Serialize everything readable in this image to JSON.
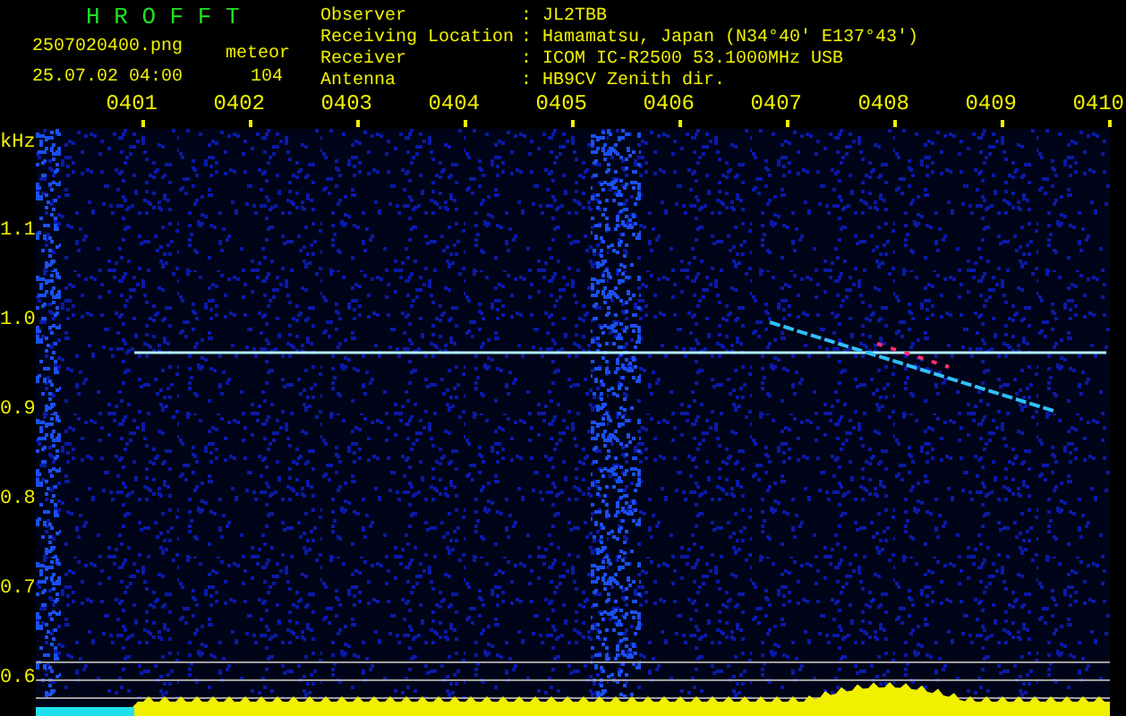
{
  "header": {
    "title": "H R O F F T",
    "file_name": "2507020400.png",
    "mode": "meteor",
    "date_time": "25.07.02 04:00",
    "count": "104"
  },
  "station": [
    {
      "label": "Observer",
      "separator": ":",
      "value": "JL2TBB"
    },
    {
      "label": "Receiving Location",
      "separator": ":",
      "value": "Hamamatsu, Japan (N34°40' E137°43')"
    },
    {
      "label": "Receiver",
      "separator": ":",
      "value": "ICOM IC-R2500 53.1000MHz USB"
    },
    {
      "label": "Antenna",
      "separator": ":",
      "value": "HB9CV Zenith dir."
    }
  ],
  "spectrogram": {
    "y_unit": "kHz",
    "x_labels": [
      "0401",
      "0402",
      "0403",
      "0404",
      "0405",
      "0406",
      "0407",
      "0408",
      "0409",
      "0410"
    ],
    "y_labels": [
      "1.1",
      "1.0",
      "0.9",
      "0.8",
      "0.7",
      "0.6"
    ]
  }
}
